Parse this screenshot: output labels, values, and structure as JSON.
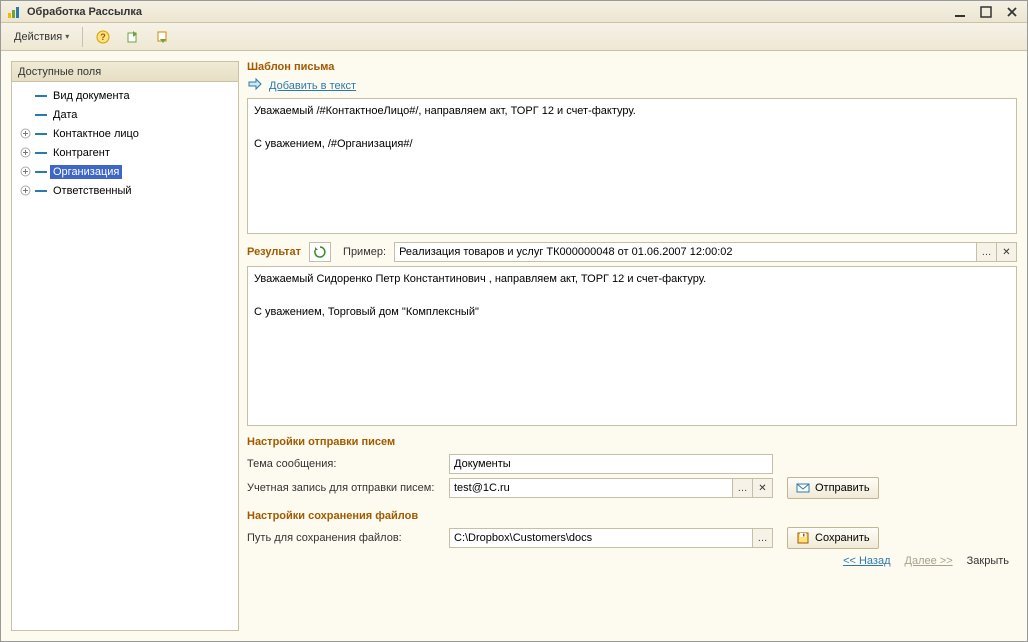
{
  "window": {
    "title": "Обработка  Рассылка"
  },
  "toolbar": {
    "actions_label": "Действия"
  },
  "left_panel": {
    "header": "Доступные поля",
    "items": [
      {
        "label": "Вид документа",
        "expandable": false,
        "selected": false
      },
      {
        "label": "Дата",
        "expandable": false,
        "selected": false
      },
      {
        "label": "Контактное лицо",
        "expandable": true,
        "selected": false
      },
      {
        "label": "Контрагент",
        "expandable": true,
        "selected": false
      },
      {
        "label": "Организация",
        "expandable": true,
        "selected": true
      },
      {
        "label": "Ответственный",
        "expandable": true,
        "selected": false
      }
    ]
  },
  "template": {
    "title": "Шаблон письма",
    "add_link": "Добавить в текст",
    "body": "Уважаемый /#КонтактноеЛицо#/, направляем акт, ТОРГ 12 и счет-фактуру.\n\nС уважением, /#Организация#/"
  },
  "result": {
    "title": "Результат",
    "example_label": "Пример:",
    "example_value": "Реализация товаров и услуг ТК000000048 от 01.06.2007 12:00:02",
    "body": "Уважаемый Сидоренко Петр Константинович , направляем акт, ТОРГ 12 и счет-фактуру.\n\nС уважением, Торговый дом \"Комплексный\""
  },
  "send_settings": {
    "title": "Настройки отправки писем",
    "subject_label": "Тема сообщения:",
    "subject_value": "Документы",
    "account_label": "Учетная запись для отправки писем:",
    "account_value": "test@1C.ru",
    "send_button": "Отправить"
  },
  "save_settings": {
    "title": "Настройки сохранения файлов",
    "path_label": "Путь для сохранения файлов:",
    "path_value": "C:\\Dropbox\\Customers\\docs",
    "save_button": "Сохранить"
  },
  "footer": {
    "back": "<< Назад",
    "next": "Далее >>",
    "close": "Закрыть"
  }
}
